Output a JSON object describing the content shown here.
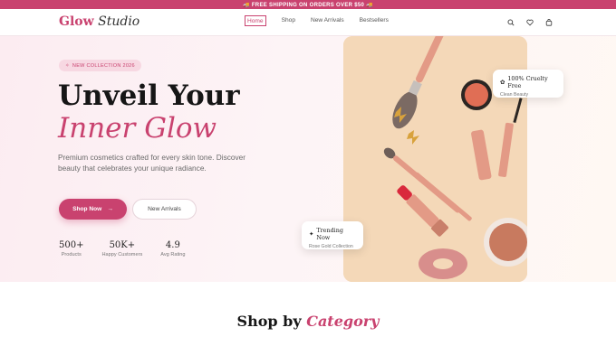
{
  "promo": {
    "text": "🚚 FREE SHIPPING ON ORDERS OVER $50 🚚"
  },
  "brand": {
    "part1": "Glow",
    "part2": "Studio"
  },
  "nav": {
    "items": [
      {
        "label": "Home",
        "active": true
      },
      {
        "label": "Shop",
        "active": false
      },
      {
        "label": "New Arrivals",
        "active": false
      },
      {
        "label": "Bestsellers",
        "active": false
      }
    ],
    "icons": [
      "search-icon",
      "heart-icon",
      "bag-icon"
    ]
  },
  "hero": {
    "badge": "NEW COLLECTION 2026",
    "title_line1": "Unveil Your",
    "title_line2": "Inner Glow",
    "description": "Premium cosmetics crafted for every skin tone. Discover beauty that celebrates your unique radiance.",
    "primary_button": "Shop Now",
    "secondary_button": "New Arrivals",
    "stats": [
      {
        "value": "500+",
        "label": "Products"
      },
      {
        "value": "50K+",
        "label": "Happy Customers"
      },
      {
        "value": "4.9",
        "label": "Avg Rating"
      }
    ]
  },
  "cards": {
    "cruelty": {
      "title": "100% Cruelty Free",
      "subtitle": "Clean Beauty"
    },
    "trending": {
      "title": "Trending Now",
      "subtitle": "Rose Gold Collection"
    }
  },
  "category": {
    "title_plain": "Shop by",
    "title_emph": "Category"
  },
  "colors": {
    "accent": "#c9426f",
    "photo_bg": "#f4d8b8",
    "rose_gold": "#e3a08a"
  }
}
